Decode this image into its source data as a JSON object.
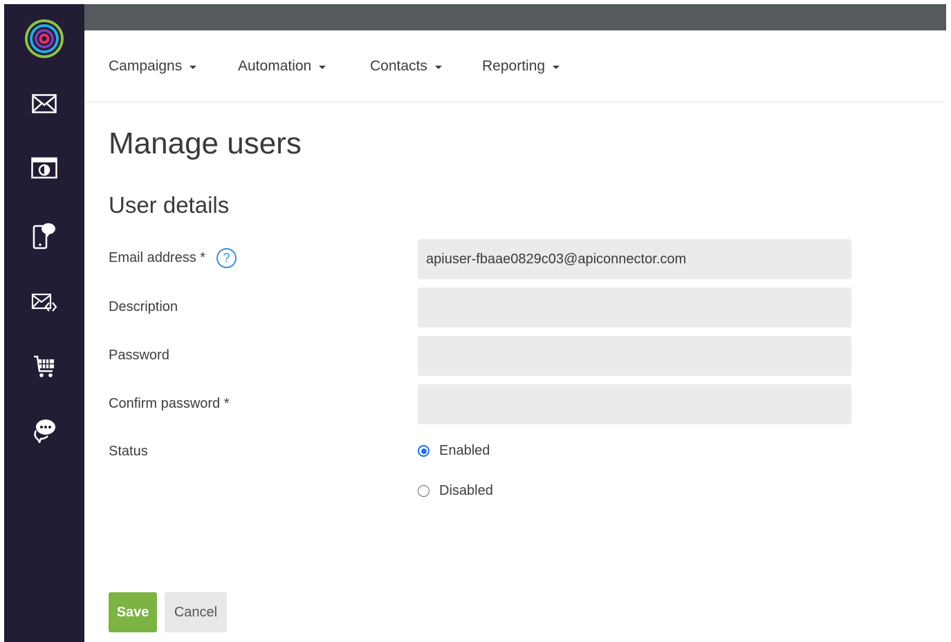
{
  "sidebar": {
    "items": [
      {
        "name": "app-logo",
        "icon": "concentric-rings-logo"
      },
      {
        "name": "email-campaigns",
        "icon": "envelope-icon"
      },
      {
        "name": "pages",
        "icon": "browser-window-icon"
      },
      {
        "name": "sms",
        "icon": "mobile-chat-icon"
      },
      {
        "name": "transactional-email",
        "icon": "envelope-code-icon"
      },
      {
        "name": "ecommerce",
        "icon": "shopping-cart-icon"
      },
      {
        "name": "chat",
        "icon": "chat-bubbles-icon"
      }
    ]
  },
  "nav": {
    "items": [
      {
        "label": "Campaigns"
      },
      {
        "label": "Automation"
      },
      {
        "label": "Contacts"
      },
      {
        "label": "Reporting"
      }
    ]
  },
  "page": {
    "title": "Manage users",
    "section_title": "User details"
  },
  "form": {
    "email": {
      "label": "Email address *",
      "value": "apiuser-fbaae0829c03@apiconnector.com",
      "help_icon": "?"
    },
    "description": {
      "label": "Description",
      "value": ""
    },
    "password": {
      "label": "Password",
      "value": ""
    },
    "confirm_password": {
      "label": "Confirm password *",
      "value": ""
    },
    "status": {
      "label": "Status",
      "options": [
        {
          "label": "Enabled",
          "checked": true
        },
        {
          "label": "Disabled",
          "checked": false
        }
      ]
    }
  },
  "actions": {
    "save_label": "Save",
    "cancel_label": "Cancel"
  },
  "colors": {
    "sidebar": "#221c35",
    "topbar": "#555a5e",
    "save_button": "#7cb342",
    "accent_blue": "#3b8fd8"
  }
}
